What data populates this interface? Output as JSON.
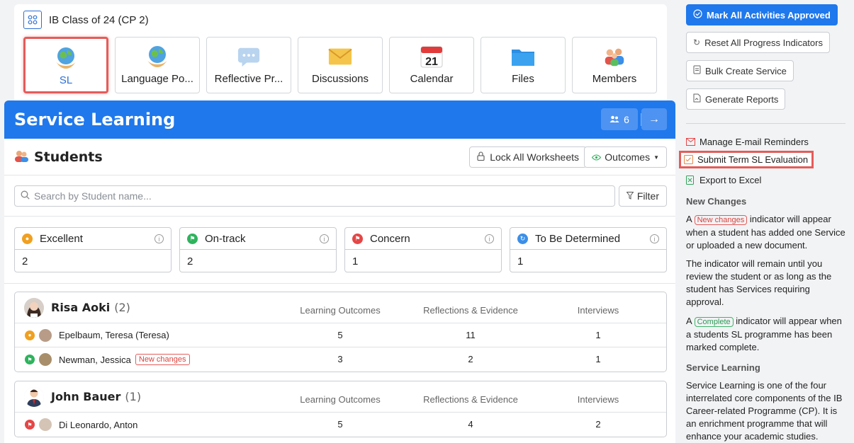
{
  "course": {
    "title": "IB Class of 24 (CP 2)",
    "tiles": [
      {
        "label": "SL",
        "icon": "globe-hands-icon",
        "active": true
      },
      {
        "label": "Language Po...",
        "icon": "globe-hands-icon"
      },
      {
        "label": "Reflective Pr...",
        "icon": "speech-bubble-icon"
      },
      {
        "label": "Discussions",
        "icon": "envelope-icon"
      },
      {
        "label": "Calendar",
        "icon": "calendar-icon",
        "day": "21"
      },
      {
        "label": "Files",
        "icon": "folder-icon"
      },
      {
        "label": "Members",
        "icon": "people-icon"
      }
    ]
  },
  "panel": {
    "title": "Service Learning",
    "member_count": "6",
    "students_title": "Students",
    "lock_label": "Lock All Worksheets",
    "outcomes_label": "Outcomes",
    "search_placeholder": "Search by Student name...",
    "filter_label": "Filter",
    "stats": [
      {
        "label": "Excellent",
        "value": "2",
        "color": "#f0a020"
      },
      {
        "label": "On-track",
        "value": "2",
        "color": "#2fb35d"
      },
      {
        "label": "Concern",
        "value": "1",
        "color": "#e54646"
      },
      {
        "label": "To Be Determined",
        "value": "1",
        "color": "#3b8fe8"
      }
    ],
    "columns": [
      "Learning Outcomes",
      "Reflections & Evidence",
      "Interviews"
    ],
    "groups": [
      {
        "name": "Risa Aoki",
        "count": "(2)",
        "rows": [
          {
            "name": "Epelbaum, Teresa (Teresa)",
            "status_color": "#f0a020",
            "badge": "",
            "lo": "5",
            "re": "11",
            "iv": "1"
          },
          {
            "name": "Newman, Jessica",
            "status_color": "#2fb35d",
            "badge": "New changes",
            "lo": "3",
            "re": "2",
            "iv": "1"
          }
        ]
      },
      {
        "name": "John Bauer",
        "count": "(1)",
        "rows": [
          {
            "name": "Di Leonardo, Anton",
            "status_color": "#e54646",
            "badge": "",
            "lo": "5",
            "re": "4",
            "iv": "2"
          }
        ]
      }
    ]
  },
  "sidebar": {
    "mark_approved": "Mark All Activities Approved",
    "reset_progress": "Reset All Progress Indicators",
    "bulk_create": "Bulk Create Service",
    "generate_reports": "Generate Reports",
    "manage_email": "Manage E-mail Reminders",
    "submit_term": "Submit Term SL Evaluation",
    "export_excel": "Export to Excel",
    "new_changes_heading": "New Changes",
    "p1_pre": "A",
    "p1_pill": "New changes",
    "p1_post": "indicator will appear when a student has added one Service or uploaded a new document.",
    "p2": "The indicator will remain until you review the student or as long as the student has Services requiring approval.",
    "p3_pre": "A",
    "p3_pill": "Complete",
    "p3_post": "indicator will appear when a students SL programme has been marked complete.",
    "sl_heading": "Service Learning",
    "p4": "Service Learning is one of the four interrelated core components of the IB Career-related Programme (CP). It is an enrichment programme that will enhance your academic studies."
  }
}
